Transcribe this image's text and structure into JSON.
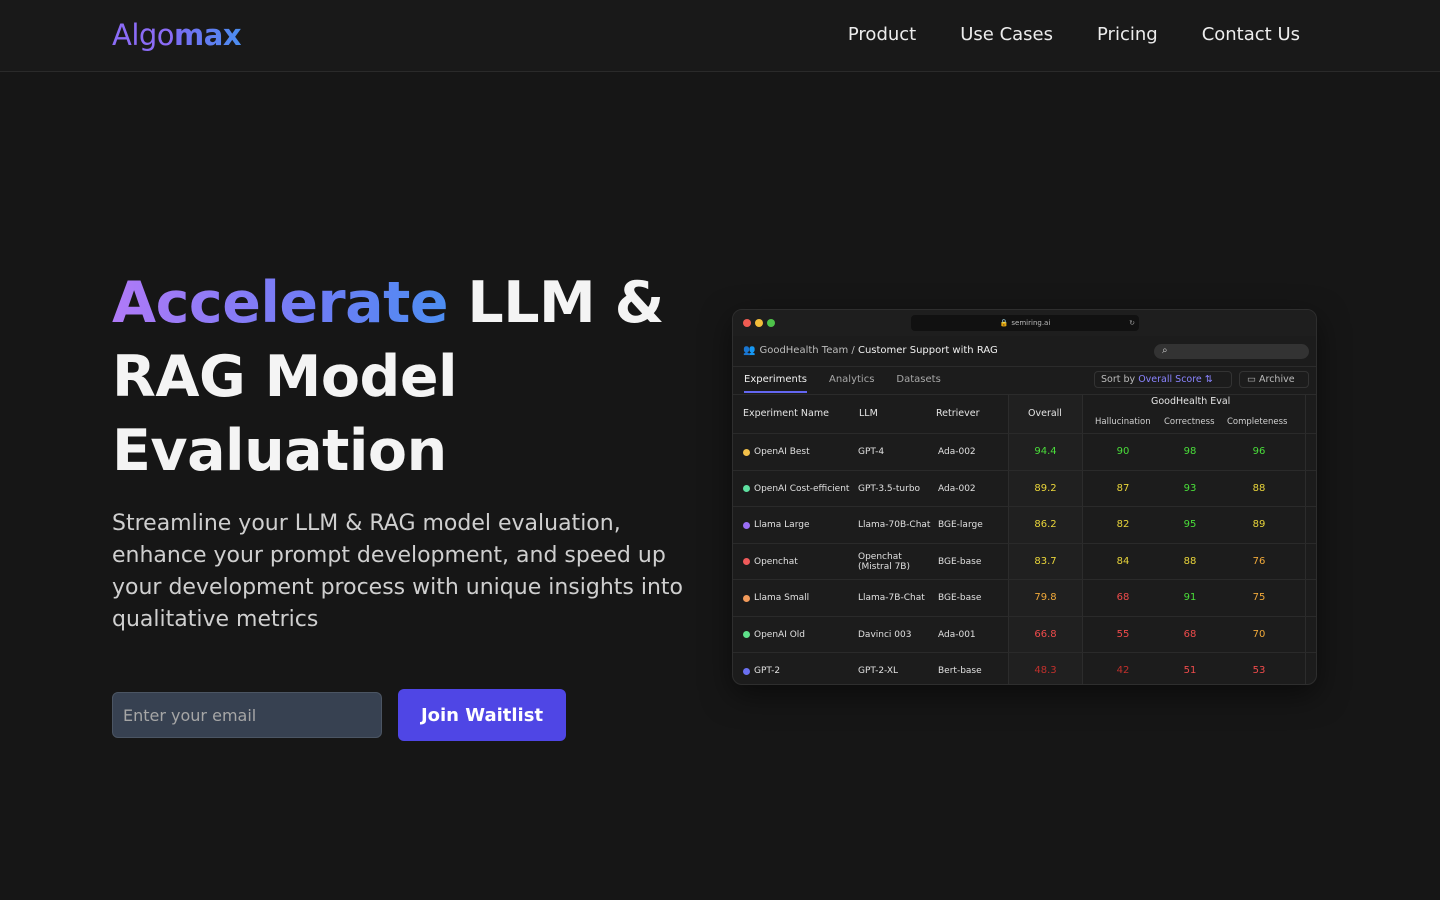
{
  "nav": {
    "logo_part1": "Algo",
    "logo_part2": "max",
    "links": [
      "Product",
      "Use Cases",
      "Pricing",
      "Contact Us"
    ]
  },
  "hero": {
    "title_highlight": "Accelerate",
    "title_line1_rest": " LLM &",
    "title_line2": "RAG Model",
    "title_line3": "Evaluation",
    "subtitle": "Streamline your LLM & RAG model evaluation, enhance your prompt development, and speed up your development process with unique insights into qualitative metrics",
    "email_placeholder": "Enter your email",
    "cta_label": "Join Waitlist"
  },
  "app": {
    "url": "semiring.ai",
    "breadcrumb_team": "GoodHealth Team /",
    "breadcrumb_page": "Customer Support with RAG",
    "tabs": [
      "Experiments",
      "Analytics",
      "Datasets"
    ],
    "sort_prefix": "Sort by",
    "sort_value": "Overall Score",
    "archive_label": "Archive",
    "headers": {
      "name": "Experiment Name",
      "llm": "LLM",
      "retriever": "Retriever",
      "overall": "Overall",
      "group": "GoodHealth Eval",
      "hallucination": "Hallucination",
      "correctness": "Correctness",
      "completeness": "Completeness"
    },
    "colors": {
      "green": "#4ade3a",
      "yellow": "#e8d43a",
      "orange": "#f0a93a",
      "red": "#ef4b4b",
      "darkred": "#c0302c",
      "accent": "#6366f1"
    },
    "rows": [
      {
        "name": "OpenAI Best",
        "dot": "#f2c04a",
        "llm": "GPT-4",
        "retriever": "Ada-002",
        "overall": "94.4",
        "hallucination": "90",
        "correctness": "98",
        "completeness": "96",
        "c": [
          "green",
          "green",
          "green",
          "green"
        ]
      },
      {
        "name": "OpenAI Cost-efficient",
        "dot": "#5ee0a0",
        "llm": "GPT-3.5-turbo",
        "retriever": "Ada-002",
        "overall": "89.2",
        "hallucination": "87",
        "correctness": "93",
        "completeness": "88",
        "c": [
          "yellow",
          "yellow",
          "green",
          "yellow"
        ]
      },
      {
        "name": "Llama Large",
        "dot": "#9a6ef5",
        "llm": "Llama-70B-Chat",
        "retriever": "BGE-large",
        "overall": "86.2",
        "hallucination": "82",
        "correctness": "95",
        "completeness": "89",
        "c": [
          "yellow",
          "yellow",
          "green",
          "yellow"
        ]
      },
      {
        "name": "Openchat",
        "dot": "#ef5a5a",
        "llm": "Openchat (Mistral 7B)",
        "retriever": "BGE-base",
        "overall": "83.7",
        "hallucination": "84",
        "correctness": "88",
        "completeness": "76",
        "c": [
          "yellow",
          "yellow",
          "yellow",
          "orange"
        ]
      },
      {
        "name": "Llama Small",
        "dot": "#f29a5a",
        "llm": "Llama-7B-Chat",
        "retriever": "BGE-base",
        "overall": "79.8",
        "hallucination": "68",
        "correctness": "91",
        "completeness": "75",
        "c": [
          "orange",
          "red",
          "green",
          "orange"
        ]
      },
      {
        "name": "OpenAI Old",
        "dot": "#5ee08a",
        "llm": "Davinci 003",
        "retriever": "Ada-001",
        "overall": "66.8",
        "hallucination": "55",
        "correctness": "68",
        "completeness": "70",
        "c": [
          "red",
          "red",
          "red",
          "orange"
        ]
      },
      {
        "name": "GPT-2",
        "dot": "#6a70f0",
        "llm": "GPT-2-XL",
        "retriever": "Bert-base",
        "overall": "48.3",
        "hallucination": "42",
        "correctness": "51",
        "completeness": "53",
        "c": [
          "darkred",
          "darkred",
          "red",
          "red"
        ]
      }
    ]
  }
}
